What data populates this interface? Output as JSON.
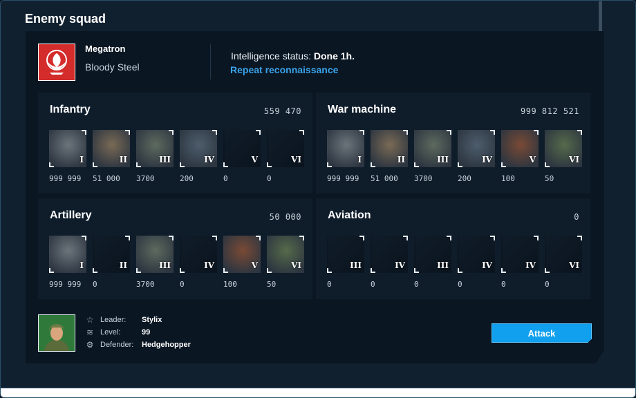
{
  "window": {
    "title": "Enemy squad"
  },
  "player": {
    "name": "Megatron",
    "clan": "Bloody Steel",
    "intel_label": "Intelligence status:",
    "intel_value": "Done 1h.",
    "recon_link": "Repeat reconnaissance"
  },
  "categories": [
    {
      "name": "Infantry",
      "total": "559 470",
      "units": [
        {
          "tier": "I",
          "count": "999 999",
          "filled": true
        },
        {
          "tier": "II",
          "count": "51 000",
          "filled": true
        },
        {
          "tier": "III",
          "count": "3700",
          "filled": true
        },
        {
          "tier": "IV",
          "count": "200",
          "filled": true
        },
        {
          "tier": "V",
          "count": "0",
          "filled": false
        },
        {
          "tier": "VI",
          "count": "0",
          "filled": false
        }
      ]
    },
    {
      "name": "War machine",
      "total": "999 812 521",
      "units": [
        {
          "tier": "I",
          "count": "999 999",
          "filled": true
        },
        {
          "tier": "II",
          "count": "51 000",
          "filled": true
        },
        {
          "tier": "III",
          "count": "3700",
          "filled": true
        },
        {
          "tier": "IV",
          "count": "200",
          "filled": true
        },
        {
          "tier": "V",
          "count": "100",
          "filled": true
        },
        {
          "tier": "VI",
          "count": "50",
          "filled": true
        }
      ]
    },
    {
      "name": "Artillery",
      "total": "50 000",
      "units": [
        {
          "tier": "I",
          "count": "999 999",
          "filled": true
        },
        {
          "tier": "II",
          "count": "0",
          "filled": false
        },
        {
          "tier": "III",
          "count": "3700",
          "filled": true
        },
        {
          "tier": "IV",
          "count": "0",
          "filled": false
        },
        {
          "tier": "V",
          "count": "100",
          "filled": true
        },
        {
          "tier": "VI",
          "count": "50",
          "filled": true
        }
      ]
    },
    {
      "name": "Aviation",
      "total": "0",
      "units": [
        {
          "tier": "III",
          "count": "0",
          "filled": false
        },
        {
          "tier": "IV",
          "count": "0",
          "filled": false
        },
        {
          "tier": "III",
          "count": "0",
          "filled": false
        },
        {
          "tier": "IV",
          "count": "0",
          "filled": false
        },
        {
          "tier": "IV",
          "count": "0",
          "filled": false
        },
        {
          "tier": "VI",
          "count": "0",
          "filled": false
        }
      ]
    }
  ],
  "leader": {
    "leader_label": "Leader:",
    "leader_value": "Stylix",
    "level_label": "Level:",
    "level_value": "99",
    "defender_label": "Defender:",
    "defender_value": "Hedgehopper"
  },
  "actions": {
    "attack_label": "Attack"
  },
  "colors": {
    "accent": "#11a0ee",
    "link": "#3aa3ea",
    "emblem": "#d42b2b",
    "avatar": "#3a8c4a"
  },
  "icons": {
    "emblem": "phoenix-emblem-icon",
    "leader": "star-icon",
    "level": "layers-icon",
    "defender": "robot-icon"
  }
}
